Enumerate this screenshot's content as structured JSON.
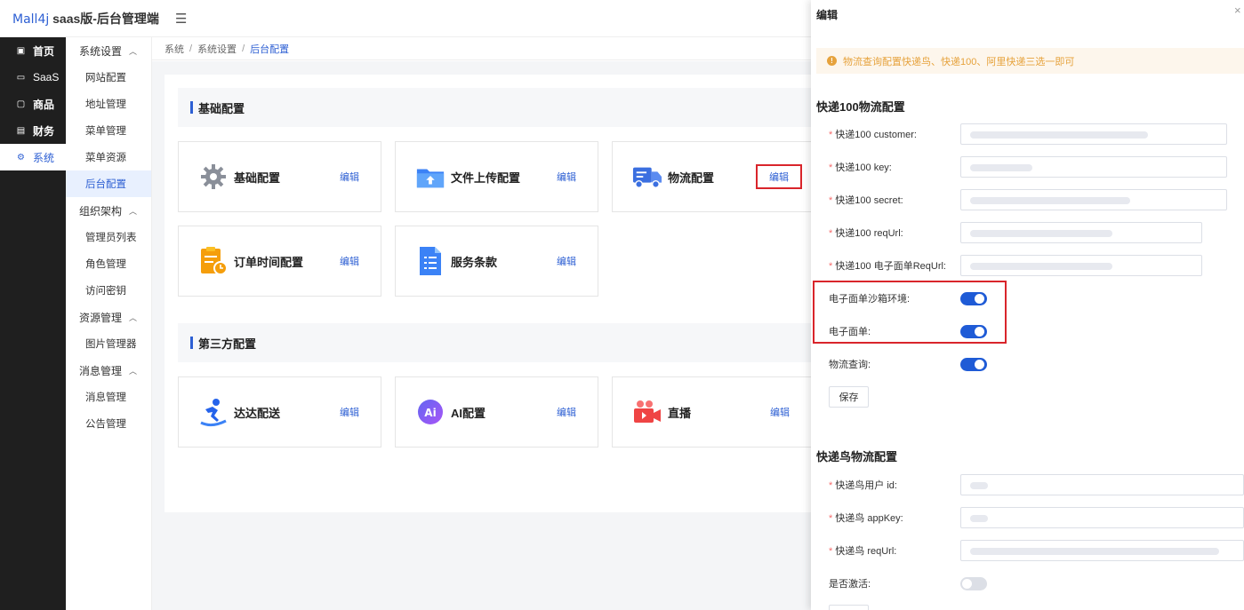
{
  "header": {
    "brand": "Mall4j",
    "title": " saas版-后台管理端",
    "menu_icon": "menu-fold-icon"
  },
  "primary_nav": [
    {
      "label": "首页",
      "icon": "home-icon",
      "active": false
    },
    {
      "label": "SaaS",
      "icon": "monitor-icon",
      "active": false
    },
    {
      "label": "商品",
      "icon": "box-icon",
      "active": false
    },
    {
      "label": "财务",
      "icon": "wallet-icon",
      "active": false
    },
    {
      "label": "系统",
      "icon": "gear-icon",
      "active": true
    }
  ],
  "secondary_nav": {
    "groups": [
      {
        "label": "系统设置",
        "items": [
          "网站配置",
          "地址管理",
          "菜单管理",
          "菜单资源",
          "后台配置"
        ]
      },
      {
        "label": "组织架构",
        "items": [
          "管理员列表",
          "角色管理",
          "访问密钥"
        ]
      },
      {
        "label": "资源管理",
        "items": [
          "图片管理器"
        ]
      },
      {
        "label": "消息管理",
        "items": [
          "消息管理",
          "公告管理"
        ]
      }
    ],
    "active_item": "后台配置"
  },
  "breadcrumb": [
    "系统",
    "系统设置",
    "后台配置"
  ],
  "sections": {
    "basic": {
      "title": "基础配置",
      "cards": [
        {
          "title": "基础配置",
          "edit": "编辑",
          "icon": "gear-icon"
        },
        {
          "title": "文件上传配置",
          "edit": "编辑",
          "icon": "folder-upload-icon"
        },
        {
          "title": "物流配置",
          "edit": "编辑",
          "icon": "truck-icon"
        },
        {
          "title": "订单时间配置",
          "edit": "编辑",
          "icon": "clipboard-clock-icon"
        },
        {
          "title": "服务条款",
          "edit": "编辑",
          "icon": "document-list-icon"
        }
      ]
    },
    "third_party": {
      "title": "第三方配置",
      "cards": [
        {
          "title": "达达配送",
          "edit": "编辑",
          "icon": "runner-icon"
        },
        {
          "title": "AI配置",
          "edit": "编辑",
          "icon": "ai-icon"
        },
        {
          "title": "直播",
          "edit": "编辑",
          "icon": "video-camera-icon"
        }
      ]
    }
  },
  "drawer": {
    "title": "编辑",
    "close": "×",
    "alert": "物流查询配置快递鸟、快递100、阿里快递三选一即可",
    "kuaidi100": {
      "title": "快递100物流配置",
      "fields": [
        {
          "label": "快递100 customer:",
          "required": true
        },
        {
          "label": "快递100 key:",
          "required": true
        },
        {
          "label": "快递100 secret:",
          "required": true
        },
        {
          "label": "快递100 reqUrl:",
          "required": true
        },
        {
          "label": "快递100 电子面单ReqUrl:",
          "required": true
        }
      ],
      "switches": [
        {
          "label": "电子面单沙箱环境:",
          "on": true
        },
        {
          "label": "电子面单:",
          "on": true
        },
        {
          "label": "物流查询:",
          "on": true
        }
      ],
      "save": "保存"
    },
    "kdniao": {
      "title": "快递鸟物流配置",
      "fields": [
        {
          "label": "快递鸟用户 id:",
          "required": true
        },
        {
          "label": "快递鸟 appKey:",
          "required": true
        },
        {
          "label": "快递鸟 reqUrl:",
          "required": true
        }
      ],
      "switches": [
        {
          "label": "是否激活:",
          "on": false
        }
      ]
    }
  },
  "colors": {
    "accent": "#2d5fd3",
    "highlight": "#d9252b",
    "warning": "#e6a23c"
  }
}
